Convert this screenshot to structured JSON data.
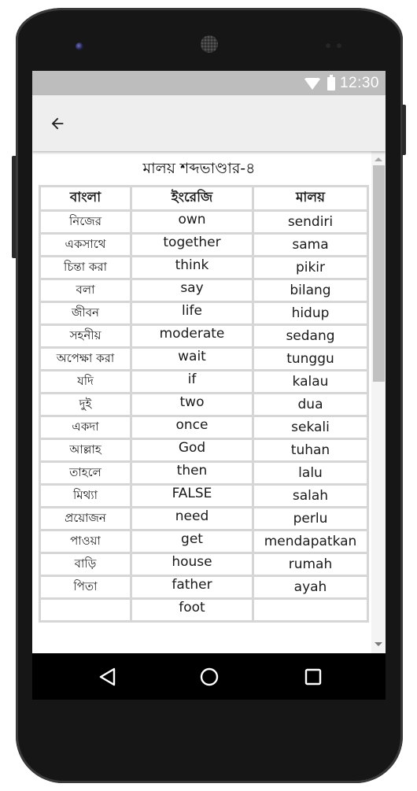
{
  "status_bar": {
    "time": "12:30",
    "icons": [
      "wifi-icon",
      "battery-icon"
    ]
  },
  "app_bar": {
    "back_icon": "arrow-left-icon"
  },
  "page": {
    "title": "মালয় শব্দভাণ্ডার-৪"
  },
  "table": {
    "headers": [
      "বাংলা",
      "ইংরেজি",
      "মালয়"
    ],
    "rows": [
      {
        "bn": "নিজের",
        "en": "own",
        "ms": "sendiri"
      },
      {
        "bn": "একসাথে",
        "en": "together",
        "ms": "sama"
      },
      {
        "bn": "চিন্তা করা",
        "en": "think",
        "ms": "pikir"
      },
      {
        "bn": "বলা",
        "en": "say",
        "ms": "bilang"
      },
      {
        "bn": "জীবন",
        "en": "life",
        "ms": "hidup"
      },
      {
        "bn": "সহনীয়",
        "en": "moderate",
        "ms": "sedang"
      },
      {
        "bn": "অপেক্ষা করা",
        "en": "wait",
        "ms": "tunggu"
      },
      {
        "bn": "যদি",
        "en": "if",
        "ms": "kalau"
      },
      {
        "bn": "দুই",
        "en": "two",
        "ms": "dua"
      },
      {
        "bn": "একদা",
        "en": "once",
        "ms": "sekali"
      },
      {
        "bn": "আল্লাহ",
        "en": "God",
        "ms": "tuhan"
      },
      {
        "bn": "তাহলে",
        "en": "then",
        "ms": "lalu"
      },
      {
        "bn": "মিথ্যা",
        "en": "FALSE",
        "ms": "salah"
      },
      {
        "bn": "প্রয়োজন",
        "en": "need",
        "ms": "perlu"
      },
      {
        "bn": "পাওয়া",
        "en": "get",
        "ms": "mendapatkan"
      },
      {
        "bn": "বাড়ি",
        "en": "house",
        "ms": "rumah"
      },
      {
        "bn": "পিতা",
        "en": "father",
        "ms": "ayah"
      },
      {
        "bn": "",
        "en": "foot",
        "ms": ""
      }
    ]
  },
  "nav_bar": {
    "buttons": [
      "back-triangle-icon",
      "home-circle-icon",
      "recents-square-icon"
    ]
  },
  "colors": {
    "status_bar": "#bdbdbd",
    "app_bar": "#eeeeee",
    "table_border": "#d6d6d6",
    "nav_bar": "#000000",
    "phone_body": "#161616"
  }
}
